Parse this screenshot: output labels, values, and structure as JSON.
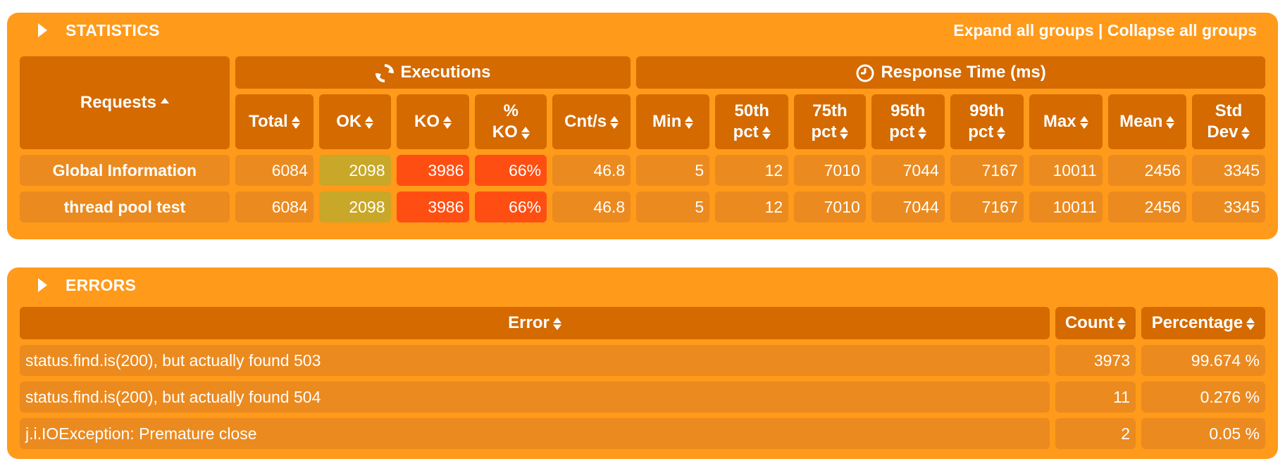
{
  "statistics": {
    "title": "STATISTICS",
    "expand_all": "Expand all groups",
    "separator": "|",
    "collapse_all": "Collapse all groups",
    "group_headers": {
      "requests": "Requests",
      "executions": "Executions",
      "response_time": "Response Time (ms)"
    },
    "icons": {
      "executions": "refresh-icon",
      "response_time": "clock-icon",
      "toggle": "caret-right-icon"
    },
    "columns": {
      "total": "Total",
      "ok": "OK",
      "ko_l1": "%",
      "ko_l2": "KO",
      "ko": "KO",
      "cnt": "Cnt/s",
      "min": "Min",
      "p50_l1": "50th",
      "p50_l2": "pct",
      "p75_l1": "75th",
      "p75_l2": "pct",
      "p95_l1": "95th",
      "p95_l2": "pct",
      "p99_l1": "99th",
      "p99_l2": "pct",
      "max": "Max",
      "mean": "Mean",
      "std_l1": "Std",
      "std_l2": "Dev"
    },
    "rows": [
      {
        "name": "Global Information",
        "total": "6084",
        "ok": "2098",
        "ko": "3986",
        "ko_pct": "66%",
        "cnt_per_s": "46.8",
        "min": "5",
        "p50": "12",
        "p75": "7010",
        "p95": "7044",
        "p99": "7167",
        "max": "10011",
        "mean": "2456",
        "std_dev": "3345"
      },
      {
        "name": "thread pool test",
        "total": "6084",
        "ok": "2098",
        "ko": "3986",
        "ko_pct": "66%",
        "cnt_per_s": "46.8",
        "min": "5",
        "p50": "12",
        "p75": "7010",
        "p95": "7044",
        "p99": "7167",
        "max": "10011",
        "mean": "2456",
        "std_dev": "3345"
      }
    ]
  },
  "errors": {
    "title": "ERRORS",
    "columns": {
      "error": "Error",
      "count": "Count",
      "percentage": "Percentage"
    },
    "rows": [
      {
        "error": "status.find.is(200), but actually found 503",
        "count": "3973",
        "percentage": "99.674 %"
      },
      {
        "error": "status.find.is(200), but actually found 504",
        "count": "11",
        "percentage": "0.276 %"
      },
      {
        "error": "j.i.IOException: Premature close",
        "count": "2",
        "percentage": "0.05 %"
      }
    ]
  },
  "colors": {
    "panel": "#ff9a1a",
    "header": "#d46a00",
    "cell": "#eb8a1f",
    "ok": "#c9a728",
    "ko": "#ff4e12",
    "text": "#ffffff"
  }
}
